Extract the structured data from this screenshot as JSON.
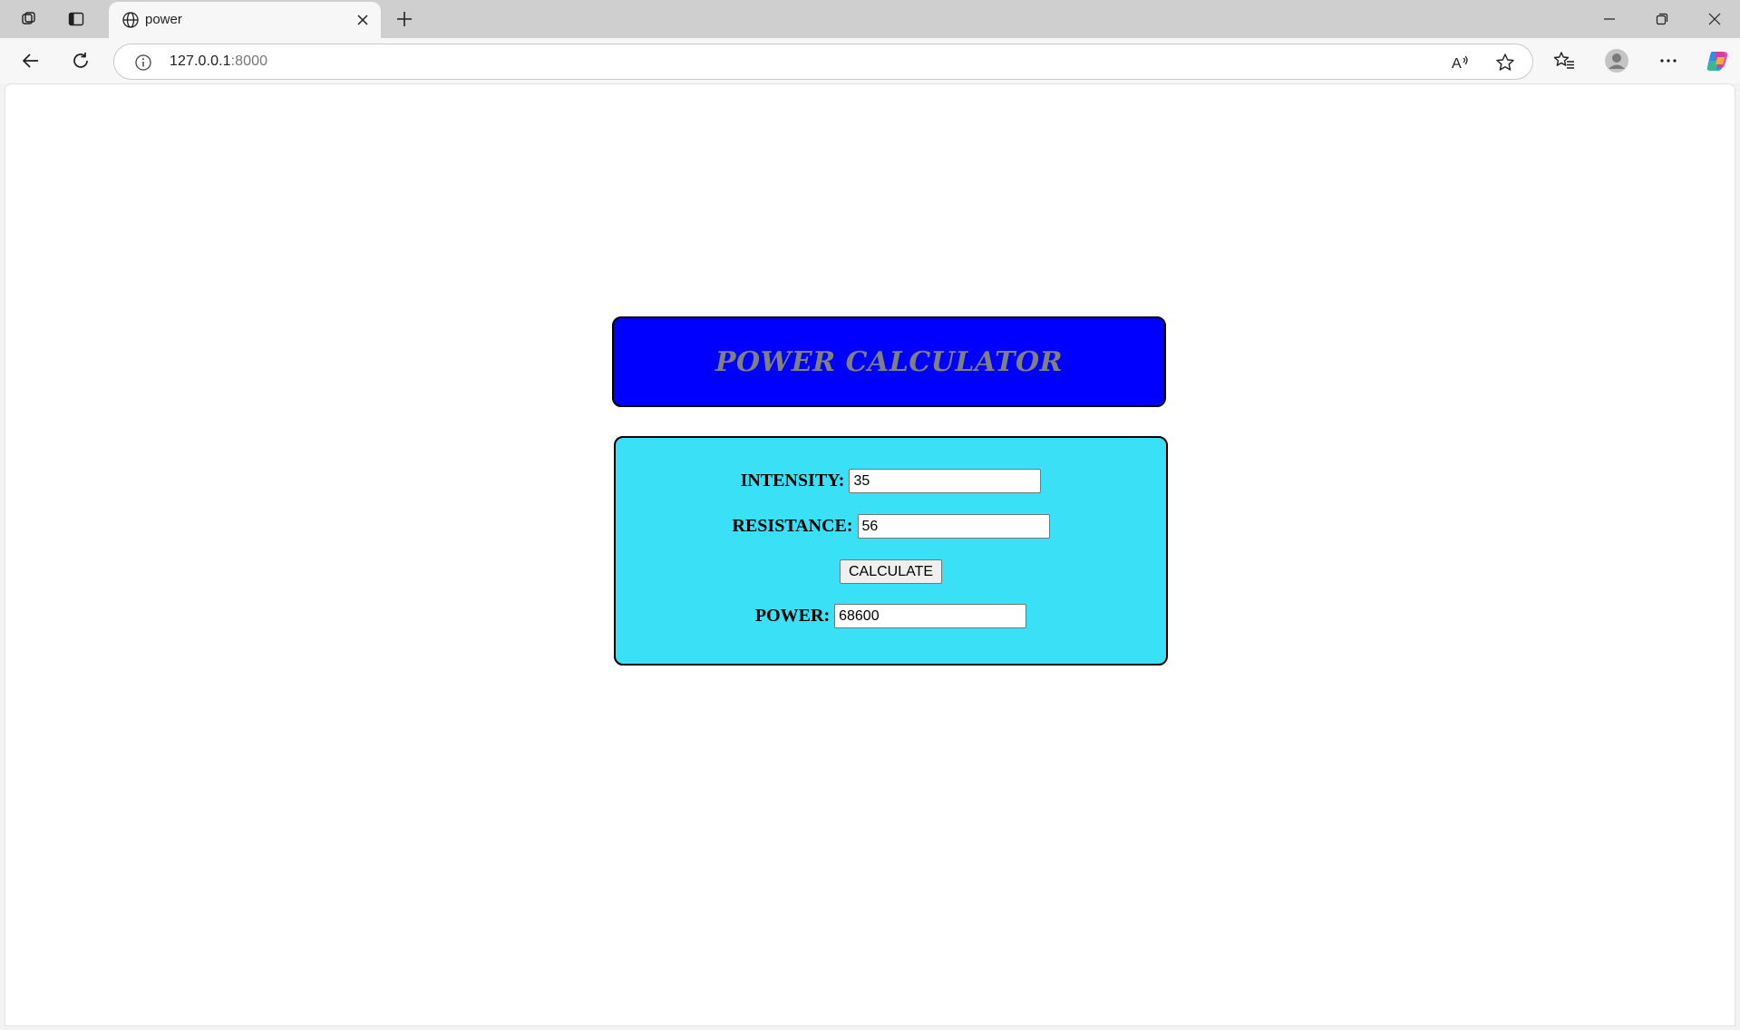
{
  "browser": {
    "tab": {
      "title": "power"
    },
    "address": {
      "host": "127.0.0.1",
      "port": ":8000"
    }
  },
  "page": {
    "title": "POWER CALCULATOR",
    "form": {
      "intensity": {
        "label": "INTENSITY:",
        "value": "35"
      },
      "resistance": {
        "label": "RESISTANCE:",
        "value": "56"
      },
      "button_label": "CALCULATE",
      "power": {
        "label": "POWER:",
        "value": "68600"
      }
    }
  },
  "colors": {
    "header_bg": "#0000ff",
    "header_text": "#808080",
    "form_bg": "#3ae0f5"
  },
  "icons": [
    "workspaces-icon",
    "vertical-tabs-icon",
    "globe-icon",
    "close-icon",
    "plus-icon",
    "minimize-icon",
    "restore-icon",
    "window-close-icon",
    "back-icon",
    "reload-icon",
    "info-icon",
    "read-aloud-icon",
    "favorite-star-icon",
    "favorites-icon",
    "profile-icon",
    "more-icon",
    "copilot-icon"
  ]
}
